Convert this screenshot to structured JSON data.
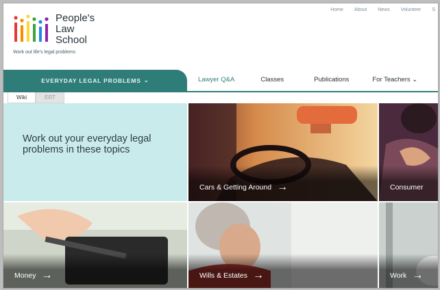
{
  "header": {
    "logo_lines": [
      "People's",
      "Law",
      "School"
    ],
    "tagline": "Work out life's legal problems",
    "utility_nav": [
      "Home",
      "About",
      "News",
      "Volunteer",
      "S"
    ]
  },
  "nav": {
    "primary": "EVERYDAY LEGAL PROBLEMS",
    "links": [
      "Lawyer Q&A",
      "Classes",
      "Publications",
      "For Teachers"
    ]
  },
  "language_tabs": [
    "Wiki",
    "ERT"
  ],
  "intro": "Work out your everyday legal problems in these topics",
  "topics": [
    {
      "label": "Cars & Getting Around"
    },
    {
      "label": "Consumer"
    },
    {
      "label": "Money"
    },
    {
      "label": "Wills & Estates"
    },
    {
      "label": "Work"
    }
  ],
  "colors": {
    "brand_teal": "#2e7d78",
    "intro_bg": "#c9ebec",
    "logo_bars": [
      "#e53935",
      "#fb8c00",
      "#fdd835",
      "#43a047",
      "#1e88e5",
      "#8e24aa"
    ]
  }
}
